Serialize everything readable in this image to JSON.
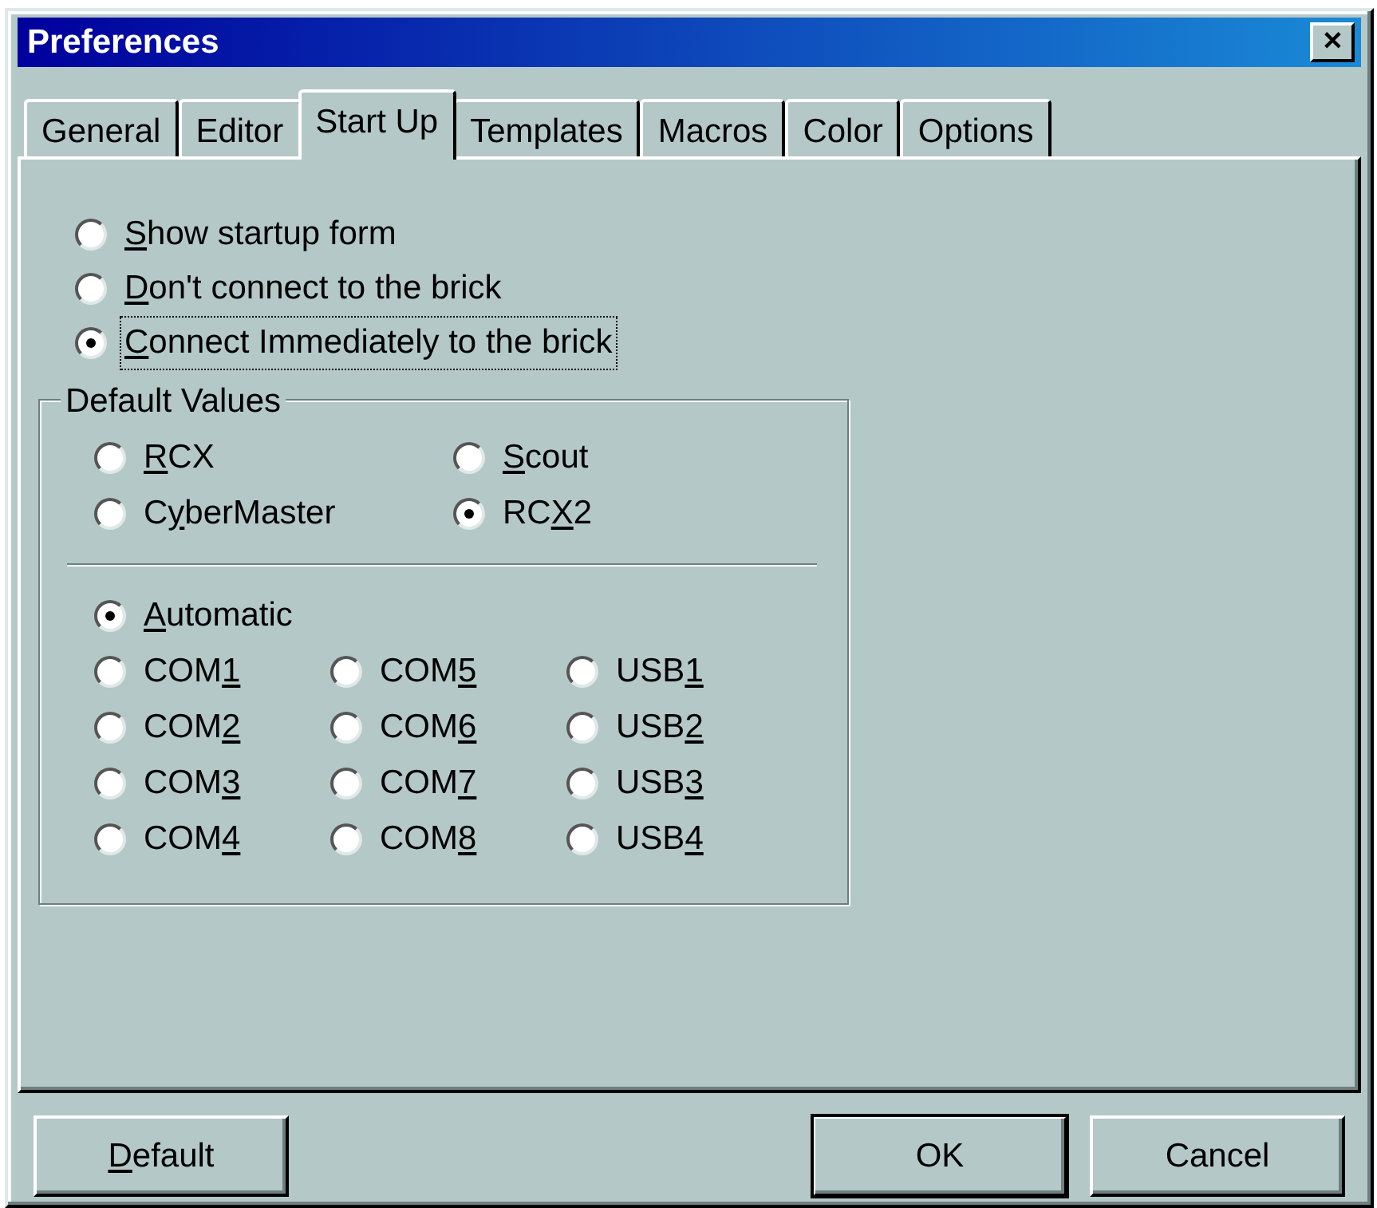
{
  "window": {
    "title": "Preferences",
    "close": "✕"
  },
  "tabs": [
    {
      "label": "General",
      "selected": false
    },
    {
      "label": "Editor",
      "selected": false
    },
    {
      "label": "Start Up",
      "selected": true
    },
    {
      "label": "Templates",
      "selected": false
    },
    {
      "label": "Macros",
      "selected": false
    },
    {
      "label": "Color",
      "selected": false
    },
    {
      "label": "Options",
      "selected": false
    }
  ],
  "startup_options": [
    {
      "accel": "S",
      "post": "how startup form",
      "selected": false,
      "focused": false
    },
    {
      "accel": "D",
      "post": "on't connect to the brick",
      "selected": false,
      "focused": false
    },
    {
      "accel": "C",
      "post": "onnect Immediately to the brick",
      "selected": true,
      "focused": true
    }
  ],
  "default_values": {
    "title": "Default Values",
    "devices": [
      {
        "accel": "R",
        "post": "CX",
        "selected": false
      },
      {
        "accel": "S",
        "post": "cout",
        "selected": false
      },
      {
        "pre": "C",
        "accel": "y",
        "post": "berMaster",
        "selected": false
      },
      {
        "pre": "RC",
        "accel": "X",
        "post": "2",
        "selected": true
      }
    ],
    "automatic": {
      "accel": "A",
      "post": "utomatic",
      "selected": true
    },
    "ports": [
      {
        "pre": "COM",
        "accel": "1",
        "selected": false
      },
      {
        "pre": "COM",
        "accel": "5",
        "selected": false
      },
      {
        "pre": "USB",
        "accel": "1",
        "selected": false
      },
      {
        "pre": "COM",
        "accel": "2",
        "selected": false
      },
      {
        "pre": "COM",
        "accel": "6",
        "selected": false
      },
      {
        "pre": "USB",
        "accel": "2",
        "selected": false
      },
      {
        "pre": "COM",
        "accel": "3",
        "selected": false
      },
      {
        "pre": "COM",
        "accel": "7",
        "selected": false
      },
      {
        "pre": "USB",
        "accel": "3",
        "selected": false
      },
      {
        "pre": "COM",
        "accel": "4",
        "selected": false
      },
      {
        "pre": "COM",
        "accel": "8",
        "selected": false
      },
      {
        "pre": "USB",
        "accel": "4",
        "selected": false
      }
    ]
  },
  "buttons": [
    {
      "accel": "D",
      "post": "efault",
      "default": false
    },
    {
      "pre": "OK",
      "default": true
    },
    {
      "pre": "Cancel",
      "default": false
    }
  ]
}
